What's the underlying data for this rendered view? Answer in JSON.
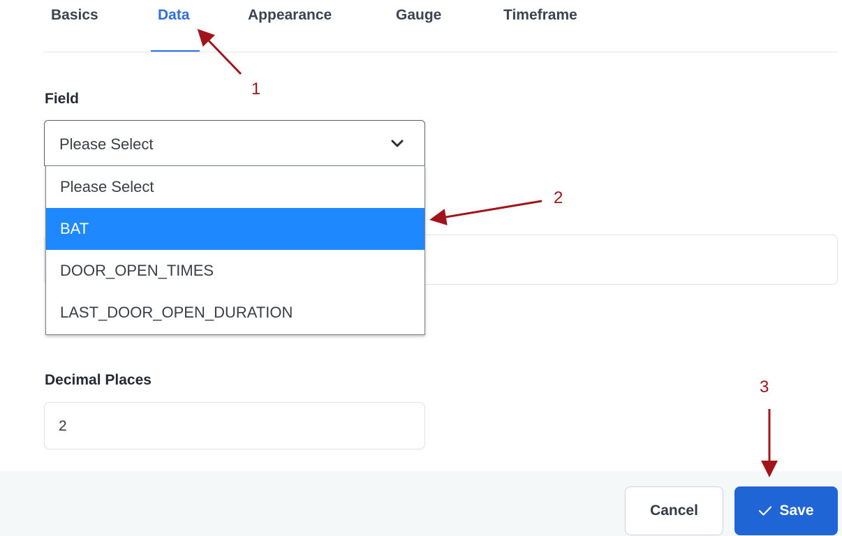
{
  "tabs": [
    {
      "label": "Basics"
    },
    {
      "label": "Data",
      "active": true
    },
    {
      "label": "Appearance"
    },
    {
      "label": "Gauge"
    },
    {
      "label": "Timeframe"
    }
  ],
  "field": {
    "label": "Field",
    "selected_value": "Please Select",
    "options": [
      {
        "label": "Please Select"
      },
      {
        "label": "BAT",
        "highlighted": true
      },
      {
        "label": "DOOR_OPEN_TIMES"
      },
      {
        "label": "LAST_DOOR_OPEN_DURATION"
      }
    ]
  },
  "decimal_places": {
    "label": "Decimal Places",
    "value": "2"
  },
  "footer": {
    "cancel_label": "Cancel",
    "save_label": "Save"
  },
  "annotations": [
    "1",
    "2",
    "3"
  ],
  "colors": {
    "accent": "#2f6fe0",
    "option_highlight": "#1e88ff",
    "save_button": "#1f65d6",
    "annotation": "#a0141a"
  },
  "icons": {
    "select_chevron": "chevron-down-icon",
    "save_check": "check-icon"
  }
}
